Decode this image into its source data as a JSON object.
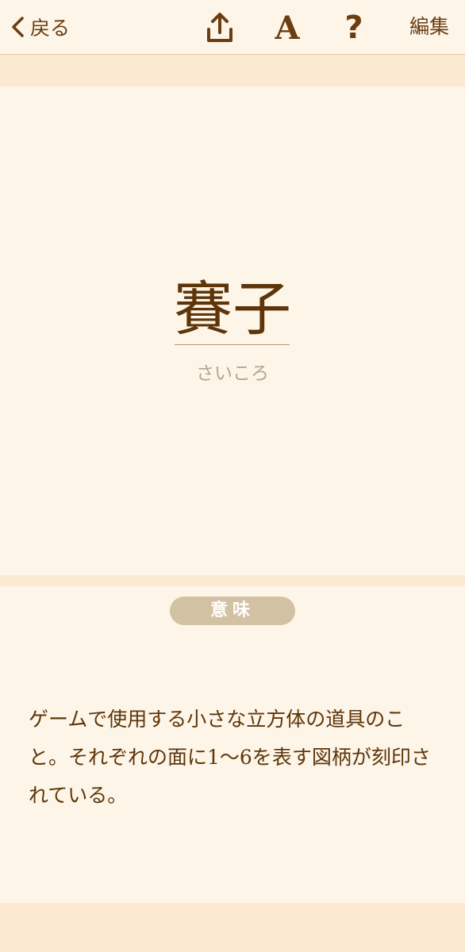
{
  "nav": {
    "back_label": "戻る",
    "share_icon": "share-upload-icon",
    "font_icon_glyph": "A",
    "help_icon_glyph": "?",
    "edit_label": "編集"
  },
  "word": {
    "kanji": "賽子",
    "reading": "さいころ"
  },
  "meaning": {
    "heading": "意味",
    "text": "ゲームで使用する小さな立方体の道具のこと。それぞれの面に1〜6を表す図柄が刻印されている。"
  },
  "colors": {
    "background": "#fdf5e8",
    "band": "#fbe9d2",
    "text": "#6b3d11",
    "reading": "#b7a48b",
    "pill": "#d3c1a4"
  }
}
